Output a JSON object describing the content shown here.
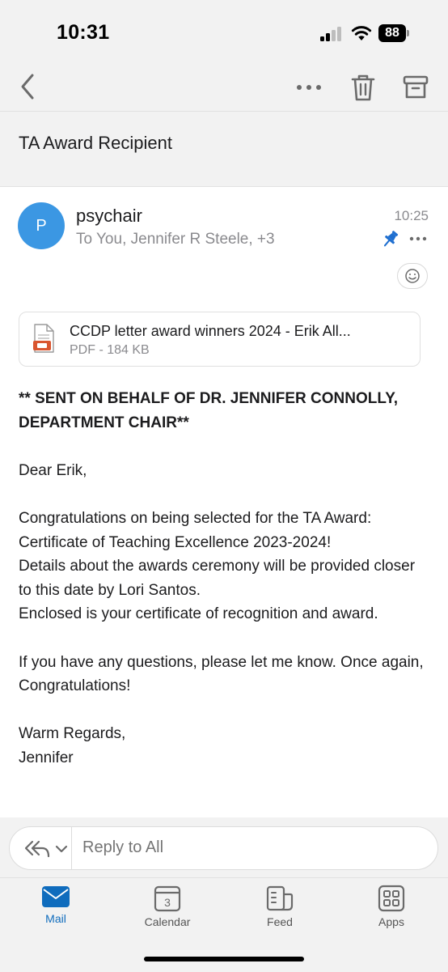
{
  "status_bar": {
    "time": "10:31",
    "battery": "88"
  },
  "toolbar": {
    "back_icon": "chevron-left-icon",
    "more_icon": "ellipsis-icon",
    "trash_icon": "trash-icon",
    "archive_icon": "archive-icon"
  },
  "email": {
    "subject": "TA Award Recipient",
    "sender": {
      "initial": "P",
      "name": "psychair",
      "recipients": "To You, Jennifer R Steele, +3",
      "time": "10:25"
    },
    "attachment": {
      "name": "CCDP letter award winners 2024 - Erik All...",
      "meta": "PDF - 184 KB"
    },
    "body": {
      "header": "** SENT ON BEHALF OF DR. JENNIFER CONNOLLY, DEPARTMENT CHAIR**",
      "greeting": "Dear Erik,",
      "paragraph1": "Congratulations on being selected for the TA Award: Certificate of Teaching Excellence 2023-2024!",
      "paragraph2": "Details about the awards ceremony will be provided closer to this date by Lori Santos.",
      "paragraph3": "Enclosed is your certificate of recognition and award.",
      "paragraph4": "If you have any questions, please let me know. Once again, Congratulations!",
      "signoff": "Warm Regards,",
      "signature": "Jennifer"
    }
  },
  "reply": {
    "placeholder": "Reply to All"
  },
  "tabs": [
    {
      "label": "Mail",
      "active": true
    },
    {
      "label": "Calendar",
      "badge": "3"
    },
    {
      "label": "Feed"
    },
    {
      "label": "Apps"
    }
  ],
  "colors": {
    "accent": "#0f6cbd",
    "avatar": "#3b97e3",
    "pin": "#1f6fd0",
    "pdf": "#d9552f"
  }
}
